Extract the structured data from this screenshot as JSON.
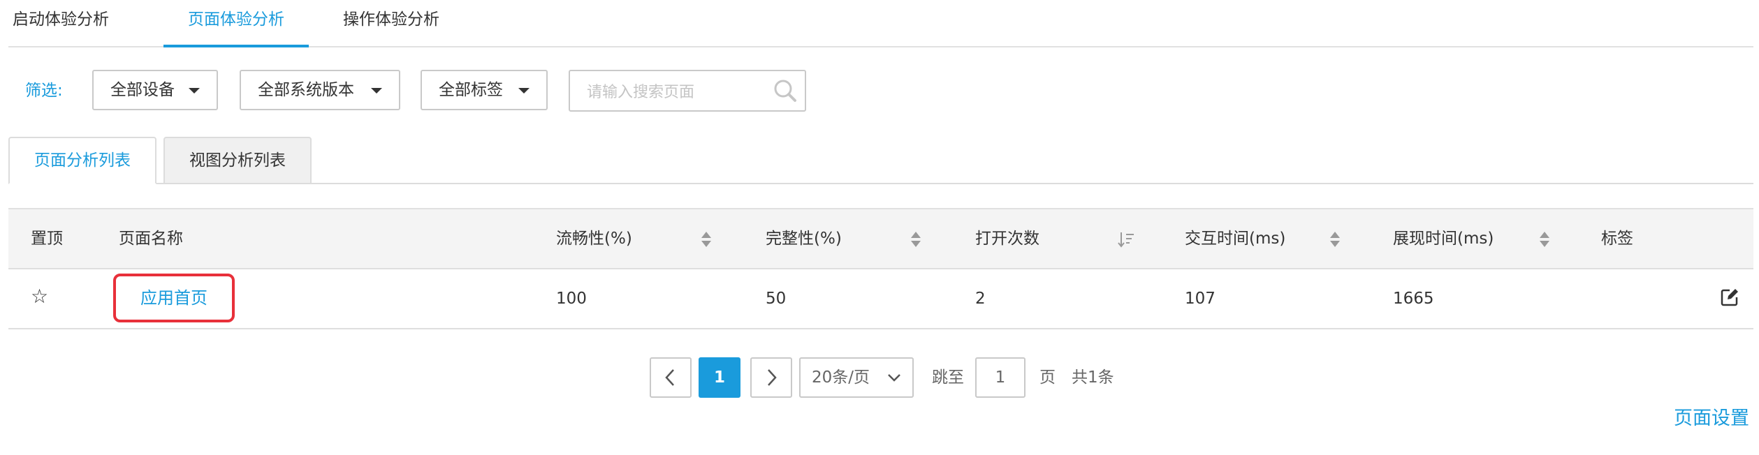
{
  "top_tabs": [
    {
      "label": "启动体验分析",
      "active": false
    },
    {
      "label": "页面体验分析",
      "active": true
    },
    {
      "label": "操作体验分析",
      "active": false
    }
  ],
  "filter": {
    "label": "筛选:",
    "device": "全部设备",
    "os_version": "全部系统版本",
    "tags": "全部标签",
    "search_placeholder": "请输入搜索页面",
    "search_value": ""
  },
  "sub_tabs": [
    {
      "label": "页面分析列表",
      "active": true
    },
    {
      "label": "视图分析列表",
      "active": false
    }
  ],
  "table": {
    "headers": [
      "置顶",
      "页面名称",
      "流畅性(%)",
      "完整性(%)",
      "打开次数",
      "交互时间(ms)",
      "展现时间(ms)",
      "标签"
    ],
    "rows": [
      {
        "pin": "☆",
        "page_name": "应用首页",
        "smoothness": "100",
        "completeness": "50",
        "open_count": "2",
        "interaction_time": "107",
        "display_time": "1665",
        "tag": ""
      }
    ]
  },
  "pagination": {
    "current_page": "1",
    "page_size": "20条/页",
    "jump_label": "跳至",
    "jump_value": "1",
    "page_unit": "页",
    "total": "共1条"
  },
  "page_settings": "页面设置",
  "colors": {
    "accent": "#1a9bdc",
    "highlight_border": "#e8303a",
    "header_bg": "#f4f4f4"
  },
  "icons": {
    "search": "search-icon",
    "sort": "sort-arrows-icon",
    "sort_desc": "sort-descending-icon",
    "star": "star-outline-icon",
    "edit": "edit-icon",
    "prev": "chevron-left-icon",
    "next": "chevron-right-icon",
    "dropdown": "caret-down-icon"
  }
}
